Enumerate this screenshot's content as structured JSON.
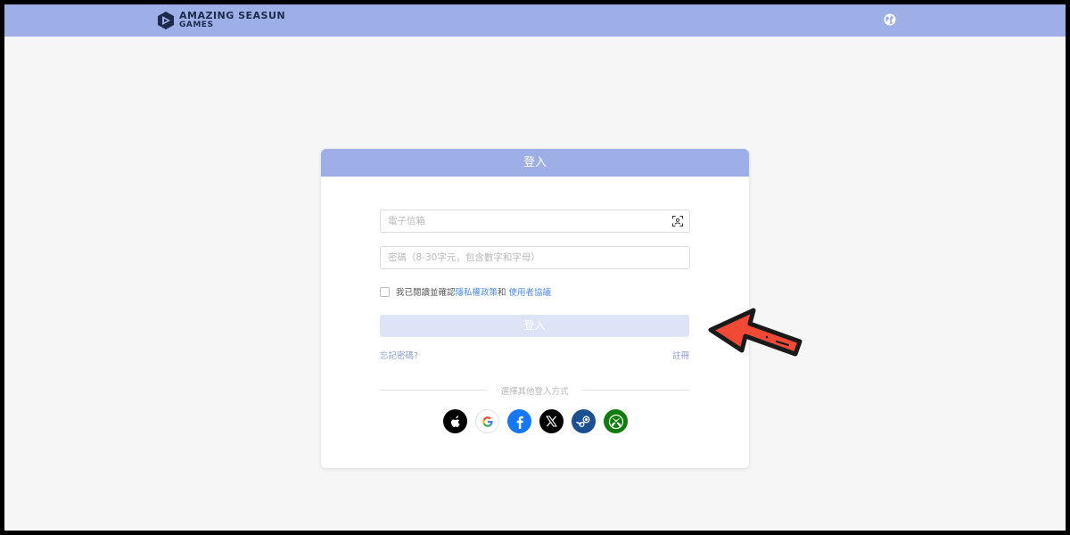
{
  "header": {
    "logo": {
      "line1": "AMAZING SEASUN",
      "line2": "GAMES"
    },
    "globe_icon": "globe-icon"
  },
  "login_card": {
    "title": "登入",
    "email_placeholder": "電子信箱",
    "password_placeholder": "密碼（8-30字元，包含數字和字母）",
    "agree_prefix": "我已閱讀並確認",
    "privacy_link": "隱私權政策",
    "agree_and": "和",
    "terms_link": "使用者協議",
    "login_button": "登入",
    "forgot_password": "忘記密碼?",
    "register": "註冊",
    "other_methods": "選擇其他登入方式"
  },
  "social_logins": [
    {
      "name": "apple",
      "bg": "#000000"
    },
    {
      "name": "google",
      "bg": "#ffffff"
    },
    {
      "name": "facebook",
      "bg": "#1877f2"
    },
    {
      "name": "x",
      "bg": "#000000"
    },
    {
      "name": "steam",
      "bg": "#1b4f8f"
    },
    {
      "name": "xbox",
      "bg": "#107c10"
    }
  ],
  "colors": {
    "accent": "#9eaee6",
    "link": "#4a8ae2",
    "button_disabled": "#dfe3f6",
    "annotation_arrow": "#f04a36"
  }
}
